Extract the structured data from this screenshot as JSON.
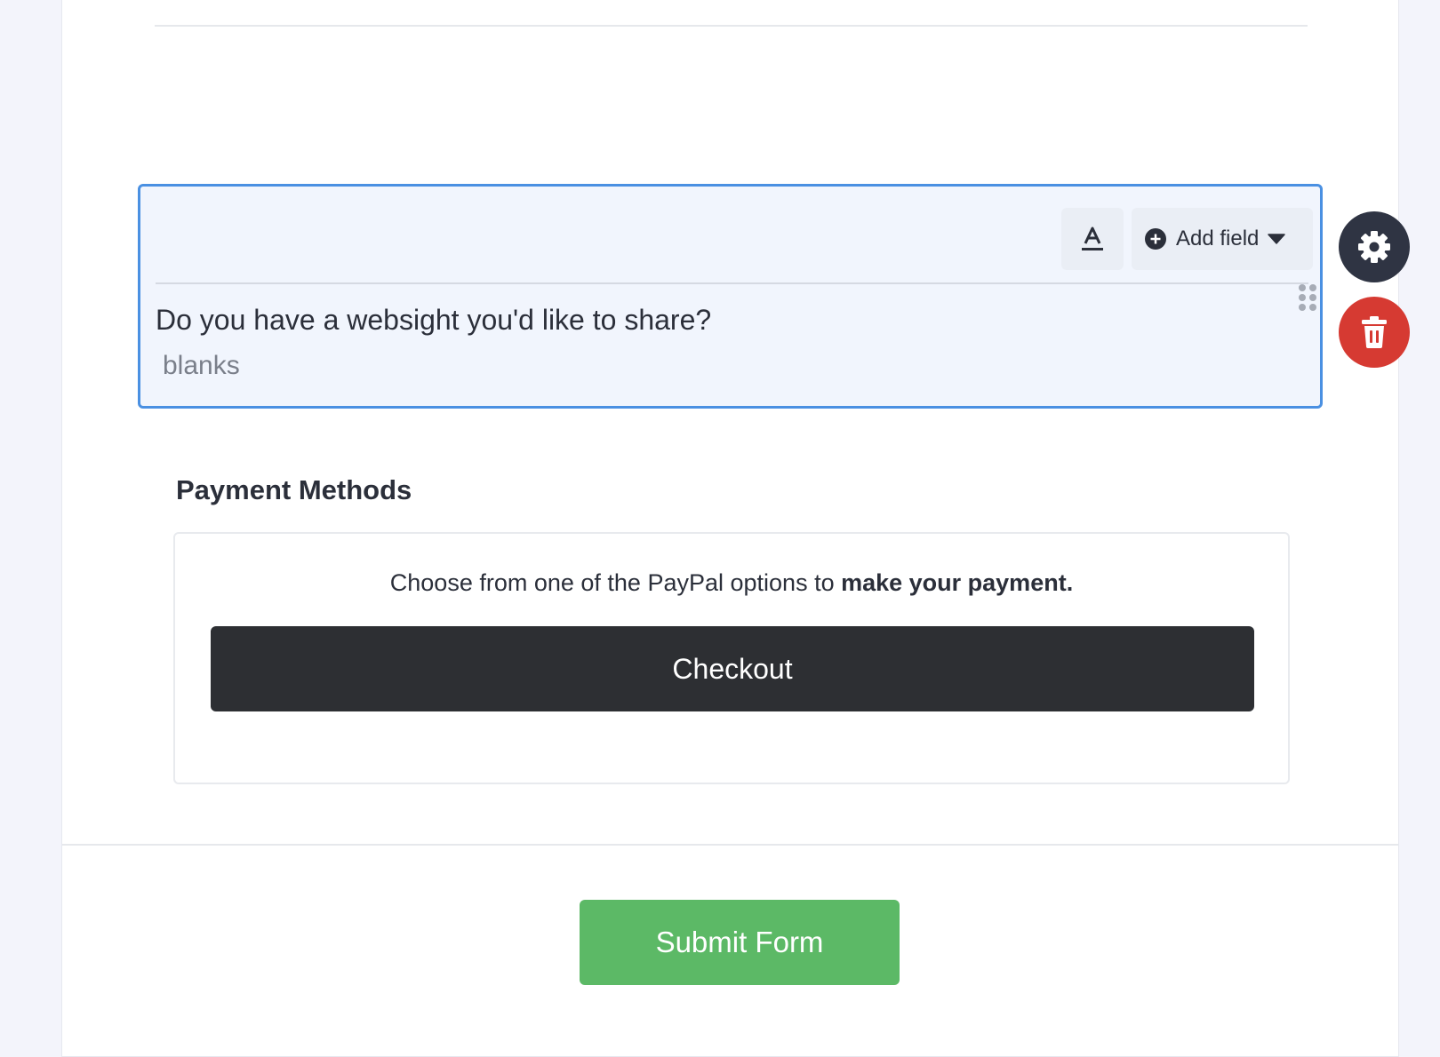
{
  "field": {
    "toolbar": {
      "text_style_icon": "text-color-icon",
      "add_field_icon": "plus-circle-icon",
      "add_field_label": "Add field",
      "dropdown_icon": "caret-down-icon"
    },
    "question": "Do you have a websight you'd like to share?",
    "answer": "blanks"
  },
  "side_actions": {
    "settings_icon": "gear-icon",
    "delete_icon": "trash-icon"
  },
  "payment": {
    "title": "Payment Methods",
    "info_text": "Choose from one of the PayPal options to ",
    "info_bold": "make your payment.",
    "checkout_label": "Checkout"
  },
  "footer": {
    "submit_label": "Submit Form"
  },
  "colors": {
    "selection_border": "#4a90e2",
    "selection_bg": "#f1f5fd",
    "settings_bg": "#2f3443",
    "delete_bg": "#d63a32",
    "checkout_bg": "#2d2f33",
    "submit_bg": "#5cb966"
  }
}
